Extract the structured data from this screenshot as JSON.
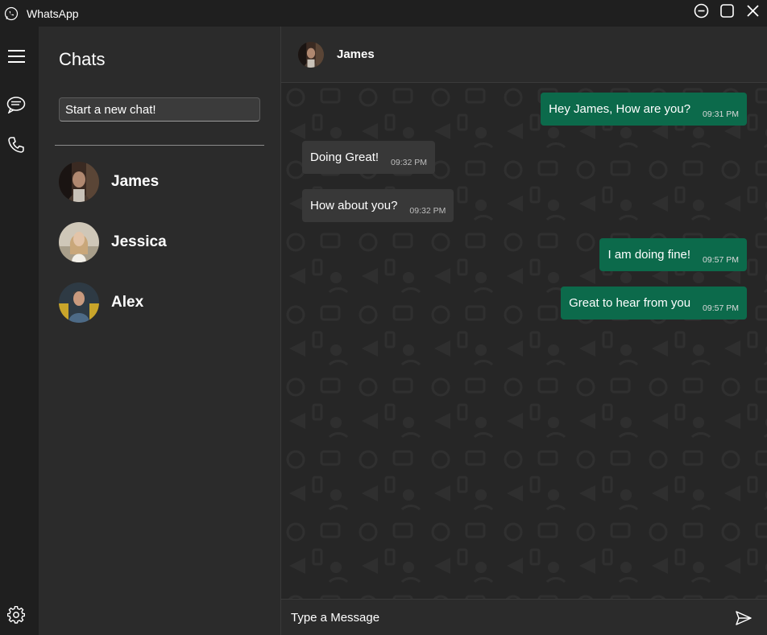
{
  "window": {
    "title": "WhatsApp",
    "controls": [
      "minimize",
      "maximize",
      "close"
    ]
  },
  "rail": {
    "items": [
      {
        "icon": "hamburger-menu-icon"
      },
      {
        "icon": "chat-bubble-icon"
      },
      {
        "icon": "phone-icon"
      },
      {
        "icon": "settings-gear-icon"
      }
    ]
  },
  "chatlist": {
    "title": "Chats",
    "search_placeholder": "Start a new chat!",
    "contacts": [
      {
        "name": "James"
      },
      {
        "name": "Jessica"
      },
      {
        "name": "Alex"
      }
    ]
  },
  "conversation": {
    "contact_name": "James",
    "messages": [
      {
        "direction": "out",
        "text": "Hey James, How are you?",
        "time": "09:31 PM"
      },
      {
        "direction": "in",
        "text": "Doing Great!",
        "time": "09:32 PM"
      },
      {
        "direction": "in",
        "text": "How about you?",
        "time": "09:32 PM"
      },
      {
        "direction": "out",
        "text": "I am doing fine!",
        "time": "09:57 PM"
      },
      {
        "direction": "out",
        "text": "Great to hear from you",
        "time": "09:57 PM"
      }
    ],
    "composer_placeholder": "Type a Message"
  },
  "colors": {
    "outgoing_bubble": "#0c6a4b",
    "incoming_bubble": "#383838",
    "panel": "#2b2b2b",
    "background": "#1f1f1f"
  }
}
